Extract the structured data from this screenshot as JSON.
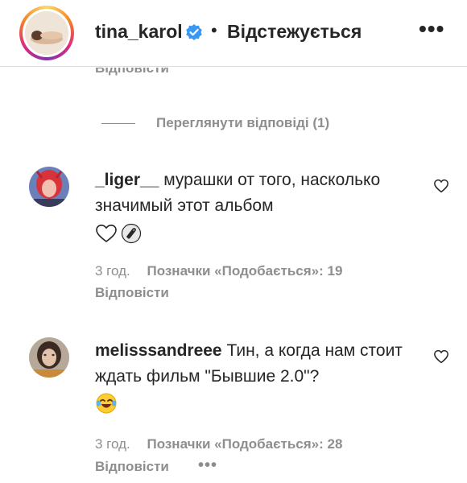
{
  "header": {
    "username": "tina_karol",
    "separator": "•",
    "follow_status": "Відстежується",
    "more_icon": "more-horizontal-icon"
  },
  "partial_reply_label": "Відповісти",
  "view_replies": "Переглянути відповіді (1)",
  "comments": [
    {
      "username": "_liger__",
      "text": "мурашки от того, насколько значимый этот альбом",
      "emoji": [
        "white-heart",
        "paperclip"
      ],
      "time": "3 год.",
      "likes": "Позначки «Подобається»: 19",
      "reply": "Відповісти"
    },
    {
      "username": "melisssandreee",
      "text": "Тин, а когда нам стоит ждать фильм \"Бывшие 2.0\"?",
      "emoji": [
        "tears-of-joy"
      ],
      "time": "3 год.",
      "likes": "Позначки «Подобається»: 28",
      "reply": "Відповісти",
      "more": "•••"
    }
  ],
  "colors": {
    "verified": "#3897f0",
    "muted": "#8e8e8e",
    "text": "#262626"
  }
}
